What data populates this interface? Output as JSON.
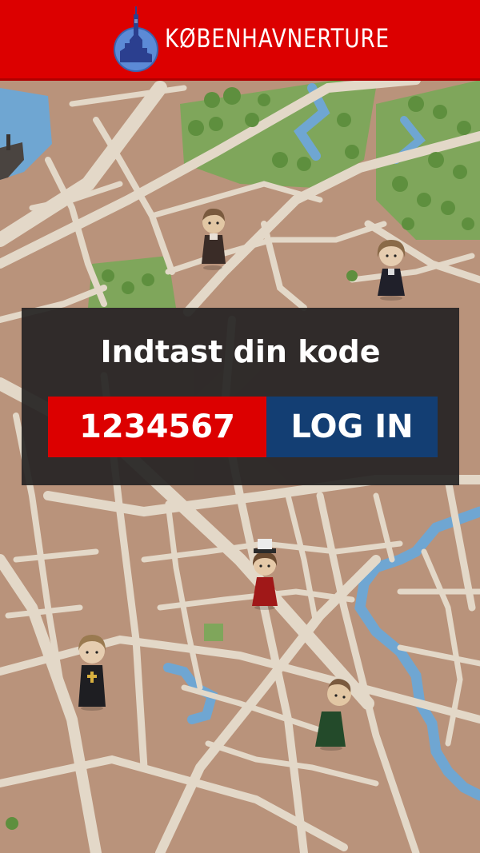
{
  "header": {
    "brand": "KØBENHAVNERTURE",
    "logo_icon": "copenhagen-tower-logo-icon"
  },
  "login": {
    "prompt": "Indtast din kode",
    "code_value": "1234567",
    "button_label": "LOG IN"
  },
  "colors": {
    "header_red": "#dc0000",
    "input_red": "#dc0000",
    "button_blue": "#133e73",
    "panel_dark": "#262423",
    "map_ground": "#b9937b",
    "map_street": "#e3d8c8",
    "map_water": "#6fa6d2",
    "map_park": "#7fa65b"
  },
  "map": {
    "avatars": [
      {
        "name": "man-brown-coat"
      },
      {
        "name": "woman-dark-dress"
      },
      {
        "name": "woman-red-dress-top-hat"
      },
      {
        "name": "priest-black-robe"
      },
      {
        "name": "man-green-coat"
      }
    ]
  }
}
